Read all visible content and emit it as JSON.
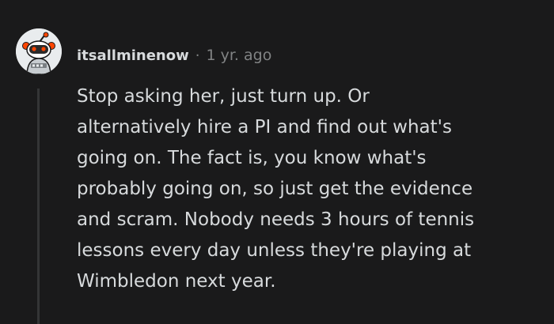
{
  "comment": {
    "username": "itsallminenow",
    "separator": "·",
    "timestamp": "1 yr. ago",
    "lines": [
      "Stop asking her, just turn up. Or",
      "alternatively hire a PI and find out what's",
      "going on. The fact is, you know what's",
      "probably going on, so just get the evidence",
      "and scram. Nobody needs 3 hours of tennis",
      "lessons every day unless they're playing at",
      "Wimbledon next year."
    ]
  },
  "colors": {
    "background": "#1a1a1b",
    "text": "#d7dadc",
    "muted": "#818384",
    "thread_line": "#343536",
    "accent": "#ff4500"
  },
  "icons": {
    "avatar": "snoo-avatar-icon"
  }
}
